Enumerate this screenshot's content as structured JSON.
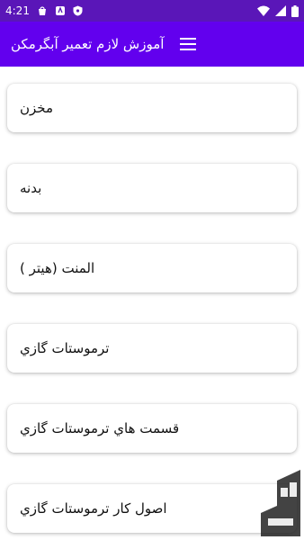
{
  "status_bar": {
    "time": "4:21"
  },
  "app_bar": {
    "title": "آموزش لازم تعمیر آبگرمکن"
  },
  "items": [
    {
      "label": "مخزن"
    },
    {
      "label": "بدنه"
    },
    {
      "label": "المنت (هيتر )"
    },
    {
      "label": "ترموستات گازي"
    },
    {
      "label": "قسمت هاي ترموستات گازي"
    },
    {
      "label": "اصول کار ترموستات گازي"
    }
  ],
  "colors": {
    "app_bar": "#6200ee",
    "status_bar": "#5a16b8",
    "background": "#ffffff"
  }
}
